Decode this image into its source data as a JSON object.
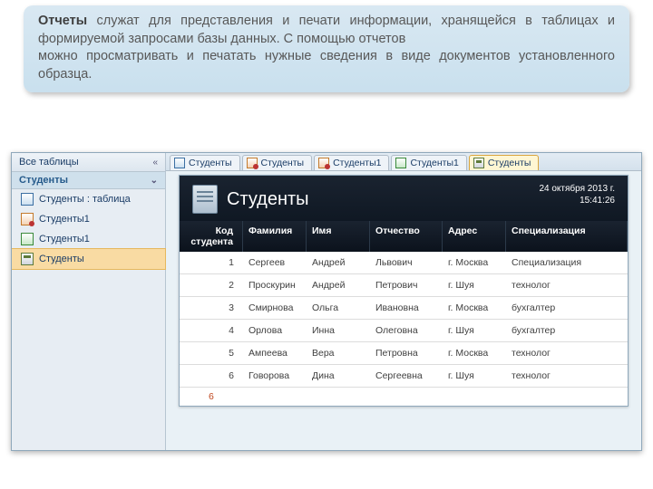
{
  "callout": {
    "bold": "Отчеты",
    "rest1": " служат для представления и печати информации, хранящейся в таблицах и формируемой запросами базы данных. С помощью отчетов",
    "rest2": " можно просматривать и печатать нужные сведения в виде документов установленного образца."
  },
  "sidebar": {
    "head": "Все таблицы",
    "group": "Студенты",
    "items": [
      {
        "label": "Студенты : таблица",
        "icon": "ic-table"
      },
      {
        "label": "Студенты1",
        "icon": "ic-query"
      },
      {
        "label": "Студенты1",
        "icon": "ic-form"
      },
      {
        "label": "Студенты",
        "icon": "ic-report",
        "selected": true
      }
    ]
  },
  "tabs": [
    {
      "label": "Студенты",
      "icon": "ic-table"
    },
    {
      "label": "Студенты",
      "icon": "ic-query"
    },
    {
      "label": "Студенты1",
      "icon": "ic-query"
    },
    {
      "label": "Студенты1",
      "icon": "ic-form"
    },
    {
      "label": "Студенты",
      "icon": "ic-report",
      "active": true
    }
  ],
  "report": {
    "title": "Студенты",
    "date": "24 октября 2013 г.",
    "time": "15:41:26",
    "columns": [
      "Код студента",
      "Фамилия",
      "Имя",
      "Отчество",
      "Адрес",
      "Специализация"
    ],
    "rows": [
      {
        "id": "1",
        "fam": "Сергеев",
        "name": "Андрей",
        "patr": "Львович",
        "addr": "г. Москва",
        "spec": "Специализация"
      },
      {
        "id": "2",
        "fam": "Проскурин",
        "name": "Андрей",
        "patr": "Петрович",
        "addr": "г. Шуя",
        "spec": "технолог"
      },
      {
        "id": "3",
        "fam": "Смирнова",
        "name": "Ольга",
        "patr": "Ивановна",
        "addr": "г. Москва",
        "spec": "бухгалтер"
      },
      {
        "id": "4",
        "fam": "Орлова",
        "name": "Инна",
        "patr": "Олеговна",
        "addr": "г. Шуя",
        "spec": "бухгалтер"
      },
      {
        "id": "5",
        "fam": "Ампеева",
        "name": "Вера",
        "patr": "Петровна",
        "addr": "г. Москва",
        "spec": "технолог"
      },
      {
        "id": "6",
        "fam": "Говорова",
        "name": "Дина",
        "patr": "Сергеевна",
        "addr": "г. Шуя",
        "spec": "технолог"
      }
    ],
    "footer_count": "6"
  }
}
